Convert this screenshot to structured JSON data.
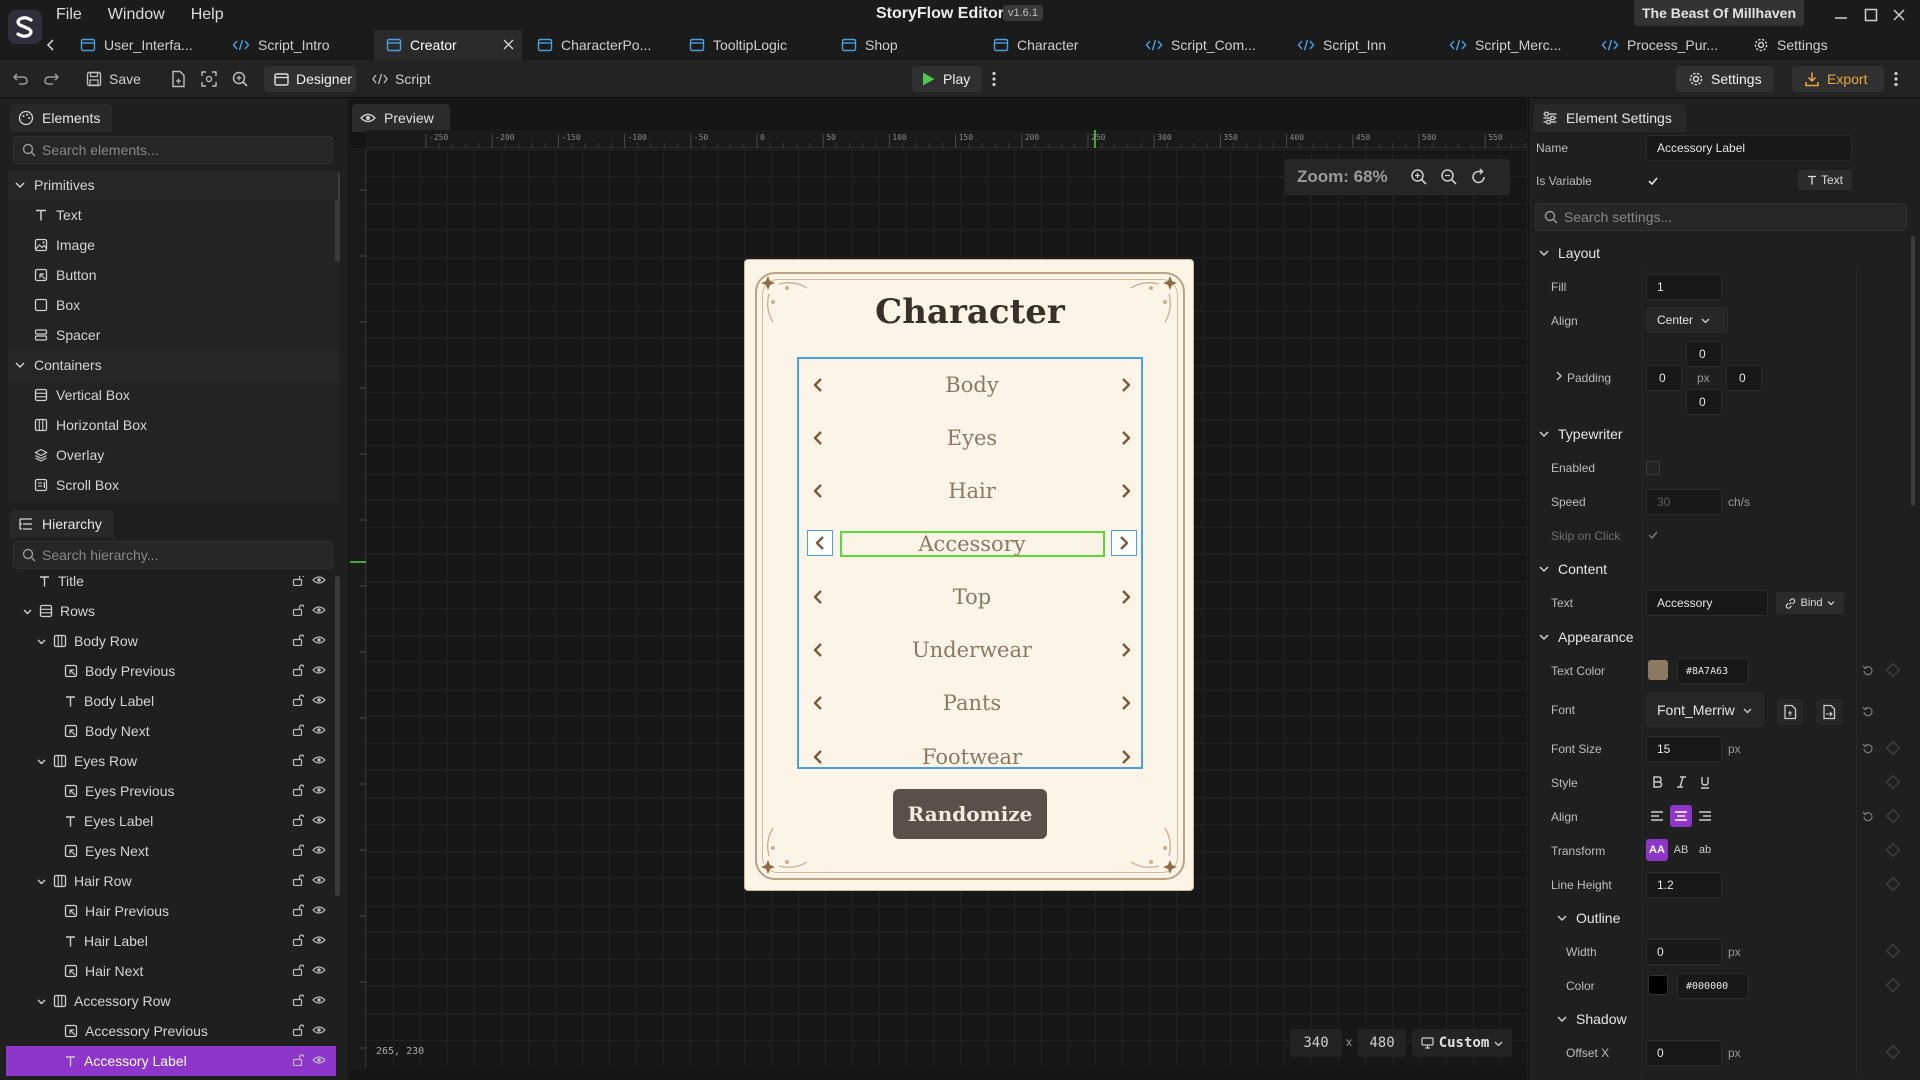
{
  "app": {
    "title": "StoryFlow Editor",
    "version": "v1.6.1",
    "project": "The Beast Of Millhaven",
    "menu": [
      "File",
      "Window",
      "Help"
    ]
  },
  "tabs": [
    {
      "label": "User_Interfa...",
      "icon": "layout-icon"
    },
    {
      "label": "Script_Intro",
      "icon": "code-icon"
    },
    {
      "label": "Creator",
      "icon": "layout-icon",
      "active": true
    },
    {
      "label": "CharacterPo...",
      "icon": "layout-icon"
    },
    {
      "label": "TooltipLogic",
      "icon": "layout-icon"
    },
    {
      "label": "Shop",
      "icon": "layout-icon"
    },
    {
      "label": "Character",
      "icon": "layout-icon"
    },
    {
      "label": "Script_Com...",
      "icon": "code-icon"
    },
    {
      "label": "Script_Inn",
      "icon": "code-icon"
    },
    {
      "label": "Script_Merc...",
      "icon": "code-icon"
    },
    {
      "label": "Process_Pur...",
      "icon": "code-icon"
    },
    {
      "label": "Settings",
      "icon": "gear-icon"
    }
  ],
  "toolbar": {
    "save": "Save",
    "designer": "Designer",
    "script": "Script",
    "play": "Play",
    "settings": "Settings",
    "export": "Export"
  },
  "elements_panel": {
    "title": "Elements",
    "search_placeholder": "Search elements...",
    "primitives_title": "Primitives",
    "primitives": [
      "Text",
      "Image",
      "Button",
      "Box",
      "Spacer"
    ],
    "containers_title": "Containers",
    "containers": [
      "Vertical Box",
      "Horizontal Box",
      "Overlay",
      "Scroll Box"
    ]
  },
  "hierarchy": {
    "title": "Hierarchy",
    "search_placeholder": "Search hierarchy...",
    "items": [
      {
        "label": "Title",
        "type": "text",
        "level": 1
      },
      {
        "label": "Rows",
        "type": "vbox",
        "level": 1,
        "expanded": true
      },
      {
        "label": "Body Row",
        "type": "hbox",
        "level": 2,
        "expanded": true
      },
      {
        "label": "Body Previous",
        "type": "button",
        "level": 3
      },
      {
        "label": "Body Label",
        "type": "text",
        "level": 3
      },
      {
        "label": "Body Next",
        "type": "button",
        "level": 3
      },
      {
        "label": "Eyes Row",
        "type": "hbox",
        "level": 2,
        "expanded": true
      },
      {
        "label": "Eyes Previous",
        "type": "button",
        "level": 3
      },
      {
        "label": "Eyes Label",
        "type": "text",
        "level": 3
      },
      {
        "label": "Eyes Next",
        "type": "button",
        "level": 3
      },
      {
        "label": "Hair Row",
        "type": "hbox",
        "level": 2,
        "expanded": true
      },
      {
        "label": "Hair Previous",
        "type": "button",
        "level": 3
      },
      {
        "label": "Hair Label",
        "type": "text",
        "level": 3
      },
      {
        "label": "Hair Next",
        "type": "button",
        "level": 3
      },
      {
        "label": "Accessory Row",
        "type": "hbox",
        "level": 2,
        "expanded": true
      },
      {
        "label": "Accessory Previous",
        "type": "button",
        "level": 3
      },
      {
        "label": "Accessory Label",
        "type": "text",
        "level": 3,
        "selected": true
      }
    ]
  },
  "preview": {
    "tab": "Preview",
    "zoom": "Zoom: 68%",
    "ruler": [
      "-250",
      "-200",
      "-150",
      "-100",
      "-50",
      "0",
      "50",
      "100",
      "150",
      "200",
      "250",
      "300",
      "350",
      "400",
      "450",
      "500",
      "550"
    ],
    "coords": "265, 230",
    "width": "340",
    "x": "x",
    "height": "480",
    "preset": "Custom"
  },
  "card": {
    "title": "Character",
    "options": [
      "Body",
      "Eyes",
      "Hair",
      "Accessory",
      "Top",
      "Underwear",
      "Pants",
      "Footwear"
    ],
    "selected_index": 3,
    "randomize": "Randomize"
  },
  "element_settings": {
    "title": "Element Settings",
    "name_label": "Name",
    "name_value": "Accessory Label",
    "is_variable_label": "Is Variable",
    "type_badge": "Text",
    "search_placeholder": "Search settings...",
    "layout": {
      "title": "Layout",
      "fill_label": "Fill",
      "fill": "1",
      "align_label": "Align",
      "align": "Center",
      "padding_label": "Padding",
      "padding_top": "0",
      "padding_left": "0",
      "padding_right": "0",
      "padding_bottom": "0",
      "padding_unit": "px"
    },
    "typewriter": {
      "title": "Typewriter",
      "enabled_label": "Enabled",
      "speed_label": "Speed",
      "speed": "30",
      "speed_unit": "ch/s",
      "skip_label": "Skip on Click"
    },
    "content": {
      "title": "Content",
      "text_label": "Text",
      "text": "Accessory",
      "bind": "Bind"
    },
    "appearance": {
      "title": "Appearance",
      "text_color_label": "Text Color",
      "text_color": "#8A7A63",
      "font_label": "Font",
      "font": "Font_Merriw",
      "font_size_label": "Font Size",
      "font_size": "15",
      "font_size_unit": "px",
      "style_label": "Style",
      "align_label": "Align",
      "transform_label": "Transform",
      "transform_options": [
        "AA",
        "AB",
        "ab"
      ],
      "line_height_label": "Line Height",
      "line_height": "1.2"
    },
    "outline": {
      "title": "Outline",
      "width_label": "Width",
      "width": "0",
      "width_unit": "px",
      "color_label": "Color",
      "color": "#000000"
    },
    "shadow": {
      "title": "Shadow",
      "offset_x_label": "Offset X",
      "offset_x": "0",
      "offset_x_unit": "px"
    }
  },
  "colors": {
    "accent_purple": "#8e36c9",
    "play_green": "#4cc94c",
    "export_orange": "#e7a83e",
    "selection_blue": "#4aa0e8",
    "label_green": "#58d63b",
    "card_bg": "#fbf4e7",
    "label_text": "#8a7a63",
    "button_dark": "#5b5049"
  }
}
